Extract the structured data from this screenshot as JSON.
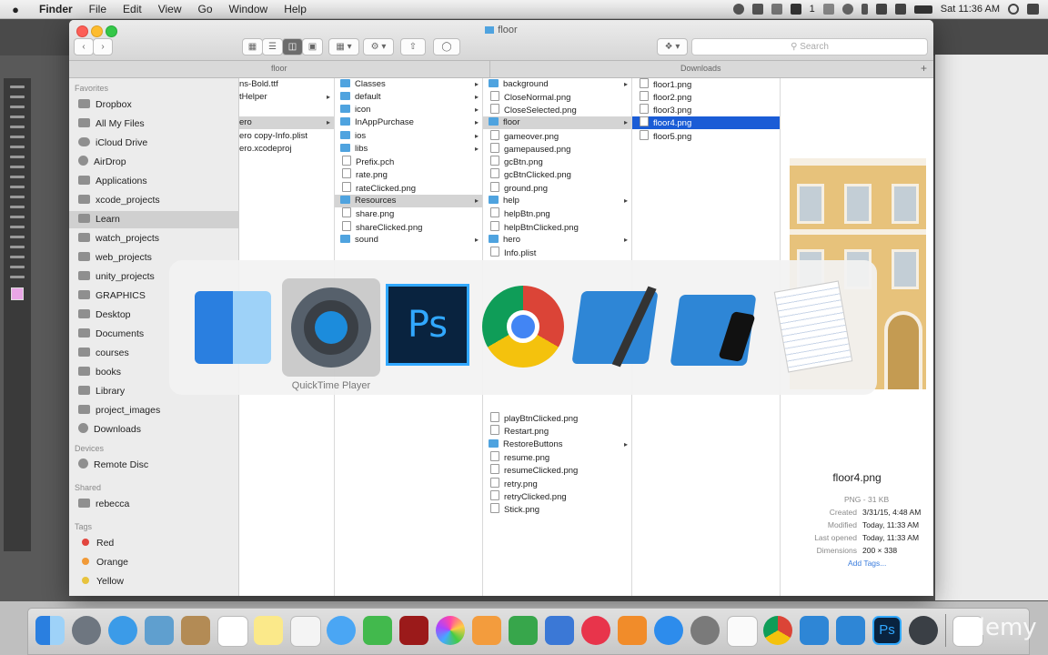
{
  "menubar": {
    "apple": "",
    "app": "Finder",
    "items": [
      "File",
      "Edit",
      "View",
      "Go",
      "Window",
      "Help"
    ],
    "status_badge": "1",
    "time": "Sat 11:36 AM"
  },
  "finder": {
    "title": "floor",
    "search_placeholder": "Search",
    "path_left": "floor",
    "path_right": "Downloads",
    "sidebar": {
      "favorites_header": "Favorites",
      "favorites": [
        "Dropbox",
        "All My Files",
        "iCloud Drive",
        "AirDrop",
        "Applications",
        "xcode_projects",
        "Learn",
        "watch_projects",
        "web_projects",
        "unity_projects",
        "GRAPHICS",
        "Desktop",
        "Documents",
        "courses",
        "books",
        "Library",
        "project_images",
        "Downloads"
      ],
      "devices_header": "Devices",
      "devices": [
        "Remote Disc"
      ],
      "shared_header": "Shared",
      "shared": [
        "rebecca"
      ],
      "tags_header": "Tags",
      "tags": [
        {
          "label": "Red",
          "color": "#e2463f"
        },
        {
          "label": "Orange",
          "color": "#f19a38"
        },
        {
          "label": "Yellow",
          "color": "#e8c33d"
        }
      ]
    },
    "col1": [
      "ns-Bold.ttf",
      "tHelper",
      "ero",
      "ero copy-Info.plist",
      "ero.xcodeproj"
    ],
    "col2": [
      "Classes",
      "default",
      "icon",
      "InAppPurchase",
      "ios",
      "libs",
      "Prefix.pch",
      "rate.png",
      "rateClicked.png",
      "Resources",
      "share.png",
      "shareClicked.png",
      "sound"
    ],
    "col3_top": [
      "background",
      "CloseNormal.png",
      "CloseSelected.png",
      "floor",
      "gameover.png",
      "gamepaused.png",
      "gcBtn.png",
      "gcBtnClicked.png",
      "ground.png",
      "help",
      "helpBtn.png",
      "helpBtnClicked.png",
      "hero",
      "Info.plist"
    ],
    "col3_bottom": [
      "playBtnClicked.png",
      "Restart.png",
      "RestoreButtons",
      "resume.png",
      "resumeClicked.png",
      "retry.png",
      "retryClicked.png",
      "Stick.png"
    ],
    "col4": [
      "floor1.png",
      "floor2.png",
      "floor3.png",
      "floor4.png",
      "floor5.png"
    ],
    "preview": {
      "name": "floor4.png",
      "kind": "PNG - 31 KB",
      "created_label": "Created",
      "created": "3/31/15, 4:48 AM",
      "modified_label": "Modified",
      "modified": "Today, 11:33 AM",
      "opened_label": "Last opened",
      "opened": "Today, 11:33 AM",
      "dimensions_label": "Dimensions",
      "dimensions": "200 × 338",
      "add_tags": "Add Tags..."
    }
  },
  "switcher": {
    "selected_label": "QuickTime Player",
    "ps_text": "Ps"
  },
  "dock": {
    "ps_text": "Ps",
    "watermark": "udemy"
  }
}
